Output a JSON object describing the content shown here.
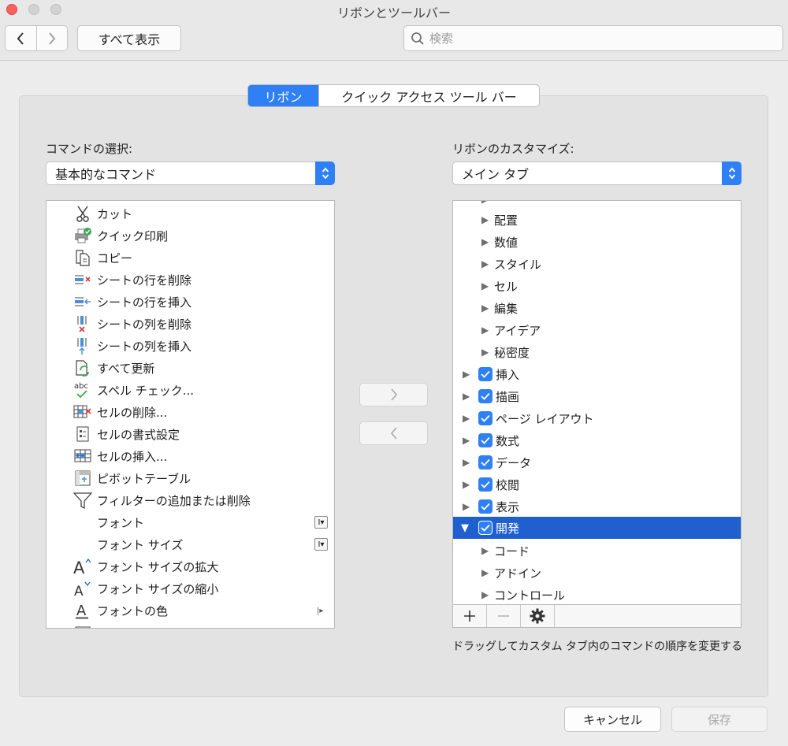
{
  "window": {
    "title": "リボンとツールバー"
  },
  "toolbar": {
    "show_all": "すべて表示",
    "search_placeholder": "検索"
  },
  "tabs": [
    {
      "label": "リボン",
      "selected": true
    },
    {
      "label": "クイック アクセス ツール バー",
      "selected": false
    }
  ],
  "left": {
    "label": "コマンドの選択:",
    "popup_value": "基本的なコマンド",
    "items": [
      {
        "label": "カット",
        "icon": "scissors-icon"
      },
      {
        "label": "クイック印刷",
        "icon": "quick-print-icon"
      },
      {
        "label": "コピー",
        "icon": "copy-icon"
      },
      {
        "label": "シートの行を削除",
        "icon": "delete-row-icon"
      },
      {
        "label": "シートの行を挿入",
        "icon": "insert-row-icon"
      },
      {
        "label": "シートの列を削除",
        "icon": "delete-column-icon"
      },
      {
        "label": "シートの列を挿入",
        "icon": "insert-column-icon"
      },
      {
        "label": "すべて更新",
        "icon": "refresh-all-icon"
      },
      {
        "label": "スペル チェック...",
        "icon": "spell-check-icon"
      },
      {
        "label": "セルの削除...",
        "icon": "delete-cells-icon"
      },
      {
        "label": "セルの書式設定",
        "icon": "format-cells-icon"
      },
      {
        "label": "セルの挿入...",
        "icon": "insert-cells-icon"
      },
      {
        "label": "ピボットテーブル",
        "icon": "pivot-table-icon"
      },
      {
        "label": "フィルターの追加または削除",
        "icon": "filter-icon"
      },
      {
        "label": "フォント",
        "icon": "",
        "badge": "I▾"
      },
      {
        "label": "フォント サイズ",
        "icon": "",
        "badge": "I▾"
      },
      {
        "label": "フォント サイズの拡大",
        "icon": "font-grow-icon"
      },
      {
        "label": "フォント サイズの縮小",
        "icon": "font-shrink-icon"
      },
      {
        "label": "フォントの色",
        "icon": "font-color-icon",
        "submenu": true
      }
    ]
  },
  "right": {
    "label": "リボンのカスタマイズ:",
    "popup_value": "メイン タブ",
    "items": [
      {
        "label": "配置",
        "level": 2
      },
      {
        "label": "数値",
        "level": 2
      },
      {
        "label": "スタイル",
        "level": 2
      },
      {
        "label": "セル",
        "level": 2
      },
      {
        "label": "編集",
        "level": 2
      },
      {
        "label": "アイデア",
        "level": 2
      },
      {
        "label": "秘密度",
        "level": 2
      },
      {
        "label": "挿入",
        "level": 1,
        "checked": true
      },
      {
        "label": "描画",
        "level": 1,
        "checked": true
      },
      {
        "label": "ページ レイアウト",
        "level": 1,
        "checked": true
      },
      {
        "label": "数式",
        "level": 1,
        "checked": true
      },
      {
        "label": "データ",
        "level": 1,
        "checked": true
      },
      {
        "label": "校閲",
        "level": 1,
        "checked": true
      },
      {
        "label": "表示",
        "level": 1,
        "checked": true
      },
      {
        "label": "開発",
        "level": 1,
        "checked": true,
        "expanded": true,
        "selected": true
      },
      {
        "label": "コード",
        "level": 2
      },
      {
        "label": "アドイン",
        "level": 2
      },
      {
        "label": "コントロール",
        "level": 2
      }
    ]
  },
  "hint": "ドラッグしてカスタム タブ内のコマンドの順序を変更する",
  "buttons": {
    "cancel": "キャンセル",
    "save": "保存"
  }
}
